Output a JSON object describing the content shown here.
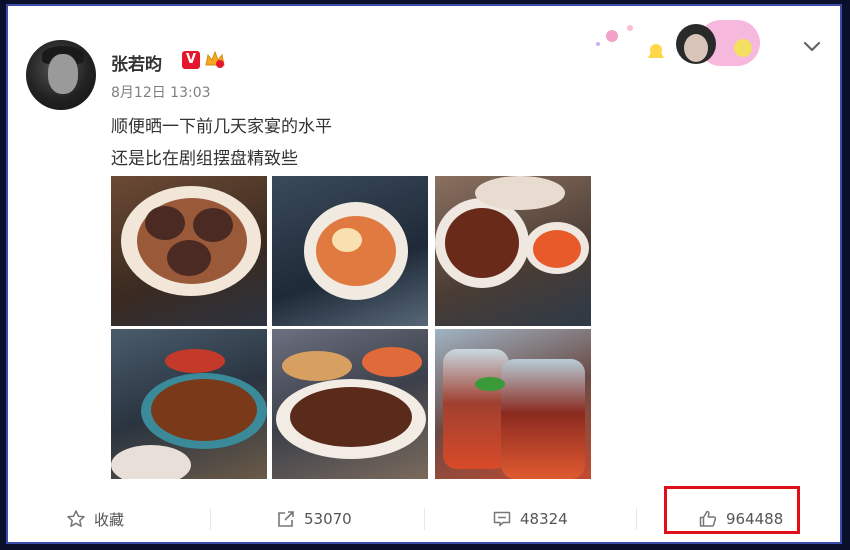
{
  "post": {
    "author": "张若昀",
    "verified_badge": "V",
    "timestamp": "8月12日 13:03",
    "text_line1": "顺便晒一下前几天家宴的水平",
    "text_line2": "还是比在剧组摆盘精致些"
  },
  "actions": {
    "favorite_label": "收藏",
    "share_count": "53070",
    "comment_count": "48324",
    "like_count": "964488"
  },
  "colors": {
    "verified": "#e6162d",
    "highlight": "#e0101a",
    "frame": "#3b4da8"
  }
}
